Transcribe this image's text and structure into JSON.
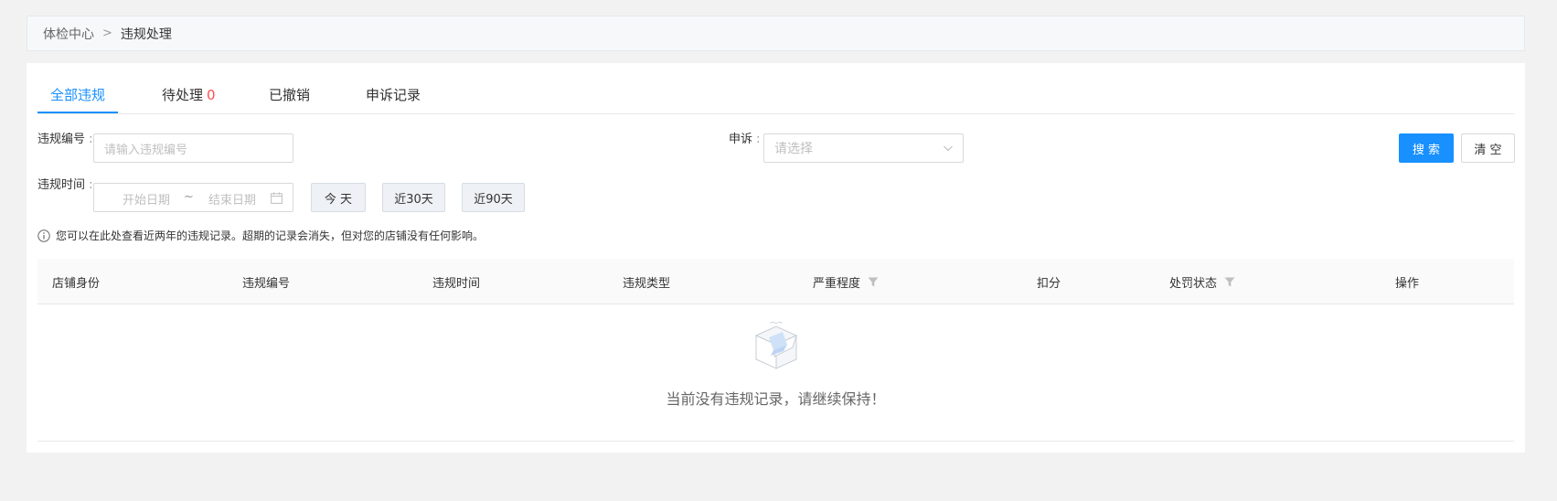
{
  "breadcrumb": {
    "parent": "体检中心",
    "separator": ">",
    "current": "违规处理"
  },
  "tabs": [
    {
      "label": "全部违规",
      "active": true
    },
    {
      "label": "待处理",
      "count": "0"
    },
    {
      "label": "已撤销"
    },
    {
      "label": "申诉记录"
    }
  ],
  "filters": {
    "violation_no_label": "违规编号",
    "violation_no_placeholder": "请输入违规编号",
    "appeal_label": "申诉",
    "appeal_placeholder": "请选择",
    "time_label": "违规时间",
    "start_placeholder": "开始日期",
    "range_sep": "~",
    "end_placeholder": "结束日期",
    "quick_today": "今 天",
    "quick_30": "近30天",
    "quick_90": "近90天",
    "search_button": "搜 索",
    "clear_button": "清 空"
  },
  "notice": "您可以在此处查看近两年的违规记录。超期的记录会消失，但对您的店铺没有任何影响。",
  "table": {
    "columns": [
      "店铺身份",
      "违规编号",
      "违规时间",
      "违规类型",
      "严重程度",
      "扣分",
      "处罚状态",
      "操作"
    ],
    "empty_text": "当前没有违规记录，请继续保持！"
  },
  "colors": {
    "accent": "#1890ff",
    "count_red": "#ff4d4f"
  }
}
